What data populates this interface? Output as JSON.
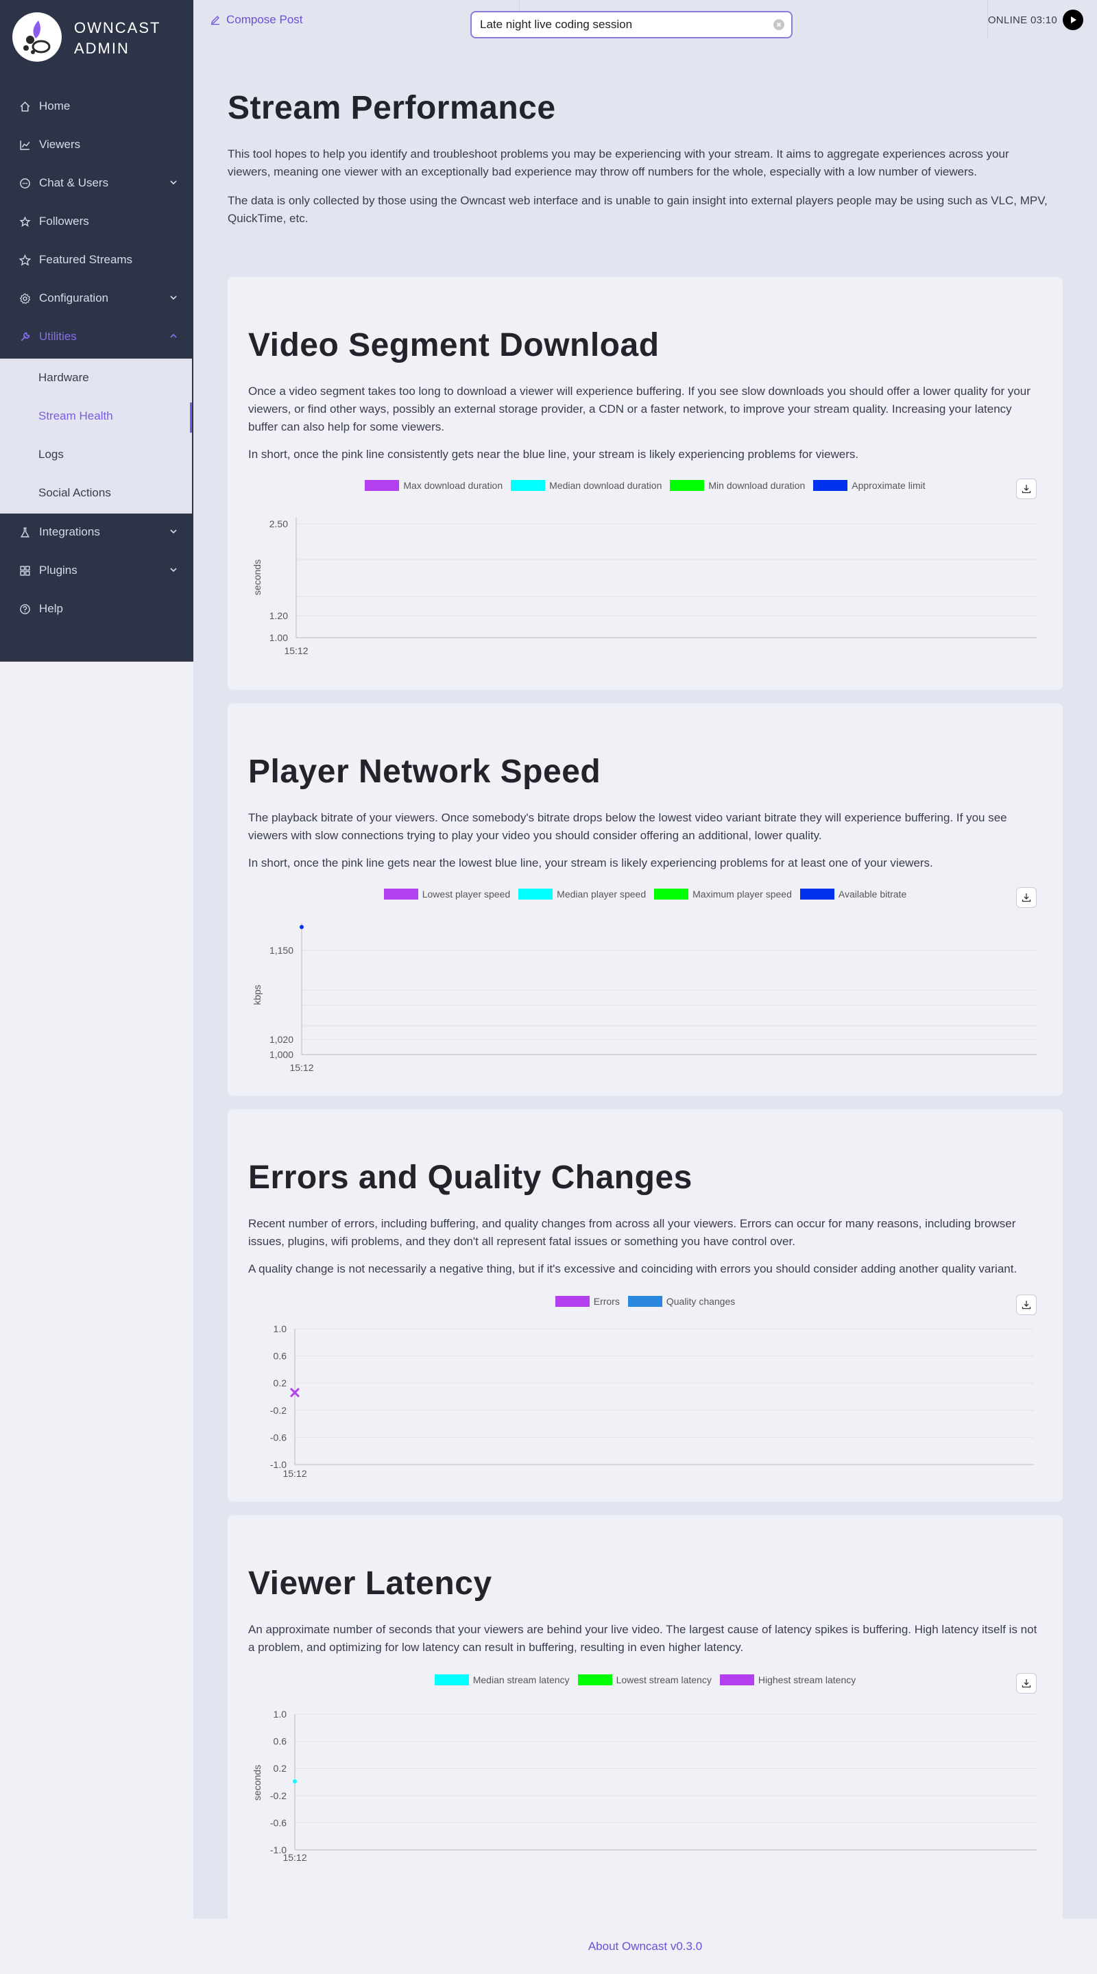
{
  "brand": {
    "name_line1": "OWNCAST",
    "name_line2": "ADMIN"
  },
  "sidebar": {
    "items": [
      {
        "label": "Home",
        "icon": "home-icon"
      },
      {
        "label": "Viewers",
        "icon": "line-chart-icon"
      },
      {
        "label": "Chat & Users",
        "icon": "message-icon"
      },
      {
        "label": "Followers",
        "icon": "followers-icon"
      },
      {
        "label": "Featured Streams",
        "icon": "star-icon"
      },
      {
        "label": "Configuration",
        "icon": "gear-icon"
      },
      {
        "label": "Utilities",
        "icon": "tool-icon"
      },
      {
        "label": "Integrations",
        "icon": "experiment-icon"
      },
      {
        "label": "Plugins",
        "icon": "appstore-icon"
      },
      {
        "label": "Help",
        "icon": "question-icon"
      }
    ],
    "utilities_sub": [
      "Hardware",
      "Stream Health",
      "Logs",
      "Social Actions"
    ]
  },
  "topbar": {
    "compose_label": "Compose Post",
    "stream_title_value": "Late night live coding session",
    "online_label": "ONLINE 03:10"
  },
  "page": {
    "title": "Stream Performance",
    "intro1": "This tool hopes to help you identify and troubleshoot problems you may be experiencing with your stream. It aims to aggregate experiences across your viewers, meaning one viewer with an exceptionally bad experience may throw off numbers for the whole, especially with a low number of viewers.",
    "intro2": "The data is only collected by those using the Owncast web interface and is unable to gain insight into external players people may be using such as VLC, MPV, QuickTime, etc."
  },
  "sections": {
    "segment": {
      "title": "Video Segment Download",
      "p1": "Once a video segment takes too long to download a viewer will experience buffering. If you see slow downloads you should offer a lower quality for your viewers, or find other ways, possibly an external storage provider, a CDN or a faster network, to improve your stream quality. Increasing your latency buffer can also help for some viewers.",
      "p2": "In short, once the pink line consistently gets near the blue line, your stream is likely experiencing problems for viewers."
    },
    "network": {
      "title": "Player Network Speed",
      "p1": "The playback bitrate of your viewers. Once somebody's bitrate drops below the lowest video variant bitrate they will experience buffering. If you see viewers with slow connections trying to play your video you should consider offering an additional, lower quality.",
      "p2": "In short, once the pink line gets near the lowest blue line, your stream is likely experiencing problems for at least one of your viewers."
    },
    "errors": {
      "title": "Errors and Quality Changes",
      "p1": "Recent number of errors, including buffering, and quality changes from across all your viewers. Errors can occur for many reasons, including browser issues, plugins, wifi problems, and they don't all represent fatal issues or something you have control over.",
      "p2": "A quality change is not necessarily a negative thing, but if it's excessive and coinciding with errors you should consider adding another quality variant."
    },
    "latency": {
      "title": "Viewer Latency",
      "p1": "An approximate number of seconds that your viewers are behind your live video. The largest cause of latency spikes is buffering. High latency itself is not a problem, and optimizing for low latency can result in buffering, resulting in even higher latency."
    }
  },
  "chart_data": [
    {
      "type": "line",
      "ylabel": "seconds",
      "x": [
        "15:12"
      ],
      "y_ticks": [
        "2.50",
        "1.20",
        "1.00"
      ],
      "series": [
        {
          "name": "Max download duration",
          "color": "#b23ff0",
          "values": []
        },
        {
          "name": "Median download duration",
          "color": "#00ffff",
          "values": []
        },
        {
          "name": "Min download duration",
          "color": "#00ff00",
          "values": []
        },
        {
          "name": "Approximate limit",
          "color": "#0033ee",
          "values": []
        }
      ]
    },
    {
      "type": "line",
      "ylabel": "kbps",
      "x": [
        "15:12"
      ],
      "y_ticks": [
        "1,150",
        "1,020",
        "1,000"
      ],
      "series": [
        {
          "name": "Lowest player speed",
          "color": "#b23ff0",
          "values": []
        },
        {
          "name": "Median player speed",
          "color": "#00ffff",
          "values": []
        },
        {
          "name": "Maximum player speed",
          "color": "#00ff00",
          "values": []
        },
        {
          "name": "Available bitrate",
          "color": "#0033ee",
          "values": [
            1200
          ]
        }
      ]
    },
    {
      "type": "line",
      "ylabel": "",
      "x": [
        "15:12"
      ],
      "y_ticks": [
        "1.0",
        "0.6",
        "0.2",
        "-0.2",
        "-0.6",
        "-1.0"
      ],
      "ylim": [
        -1,
        1
      ],
      "series": [
        {
          "name": "Errors",
          "color": "#b23ff0",
          "values": [
            0
          ]
        },
        {
          "name": "Quality changes",
          "color": "#2b86e0",
          "values": []
        }
      ]
    },
    {
      "type": "line",
      "ylabel": "seconds",
      "x": [
        "15:12"
      ],
      "y_ticks": [
        "1.0",
        "0.6",
        "0.2",
        "-0.2",
        "-0.6",
        "-1.0"
      ],
      "ylim": [
        -1,
        1
      ],
      "series": [
        {
          "name": "Median stream latency",
          "color": "#00ffff",
          "values": [
            0
          ]
        },
        {
          "name": "Lowest stream latency",
          "color": "#00ff00",
          "values": []
        },
        {
          "name": "Highest stream latency",
          "color": "#b23ff0",
          "values": []
        }
      ]
    }
  ],
  "footer": {
    "label": "About Owncast v0.3.0"
  }
}
